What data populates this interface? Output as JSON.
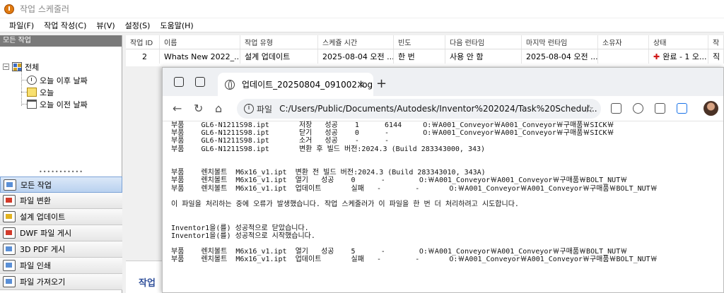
{
  "window": {
    "title": "작업 스케줄러"
  },
  "menu": [
    "파일(F)",
    "작업 작성(C)",
    "뷰(V)",
    "설정(S)",
    "도움말(H)"
  ],
  "left_panel": {
    "header": "모든 작업",
    "tree_root": "전체",
    "tree_items": [
      "오늘 이후 날짜",
      "오늘",
      "오늘 이전 날짜"
    ],
    "splitter": "•••••••••••",
    "nav_items": [
      "모든 작업",
      "파일 변환",
      "설계 업데이트",
      "DWF 파일 게시",
      "3D PDF 게시",
      "파일 인쇄",
      "파일 가져오기"
    ]
  },
  "table": {
    "headers": [
      "작업 ID",
      "이름",
      "작업 유형",
      "스케쥴 시간",
      "빈도",
      "다음 런타임",
      "마지막 런타임",
      "소유자",
      "상태",
      "작"
    ],
    "row": {
      "id": "2",
      "name": "Whats New 2022_...",
      "type": "설계 업데이트",
      "schedule": "2025-08-04 오전 ...",
      "freq": "한 번",
      "next": "사용 안 함",
      "last": "2025-08-04 오전 ...",
      "owner": "",
      "status": "완료 - 1 오...",
      "extra": "직"
    }
  },
  "bottom_label": "작업",
  "browser": {
    "tab_title": "업데이트_20250804_091002.log",
    "tab_close": "×",
    "new_tab": "+",
    "address_prefix": "파일",
    "address_url": "C:/Users/Public/Documents/Autodesk/Inventor%202024/Task%20Schedul...",
    "log_lines": [
      "부품    GL6-N1211S98.ipt       저장   성공    1      6144     O:￦A001_Conveyor￦A001_Conveyor￦구매품￦SICK￦",
      "부품    GL6-N1211S98.ipt       닫기   성공    0      -        O:￦A001_Conveyor￦A001_Conveyor￦구매품￦SICK￦",
      "부품    GL6-N1211S98.ipt       소거   성공    -      -",
      "부품    GL6-N1211S98.ipt       변환 후 빌드 버전:2024.3 (Build 283343000, 343)",
      "",
      "",
      "부품    렌치볼트  M6x16_v1.ipt  변환 전 빌드 버전:2024.3 (Build 283343010, 343A)",
      "부품    렌치볼트  M6x16_v1.ipt  열기   성공    0      -        O:￦A001_Conveyor￦A001_Conveyor￦구매품￦BOLT_NUT￦",
      "부품    렌치볼트  M6x16_v1.ipt  업데이트       실패   -        -       O:￦A001_Conveyor￦A001_Conveyor￦구매품￦BOLT_NUT￦",
      "",
      "이 파일을 처리하는 중에 오류가 발생했습니다. 작업 스케줄러가 이 파일을 한 번 더 처리하려고 시도합니다.",
      "",
      "",
      "Inventor1을(를) 성공적으로 닫았습니다.",
      "Inventor1을(를) 성공적으로 시작했습니다.",
      "",
      "부품    렌치볼트  M6x16_v1.ipt  열기   성공    5      -        O:￦A001_Conveyor￦A001_Conveyor￦구매품￦BOLT_NUT￦",
      "부품    렌치볼트  M6x16_v1.ipt  업데이트       실패   -        -       O:￦A001_Conveyor￦A001_Conveyor￦구매품￦BOLT_NUT￦"
    ]
  }
}
